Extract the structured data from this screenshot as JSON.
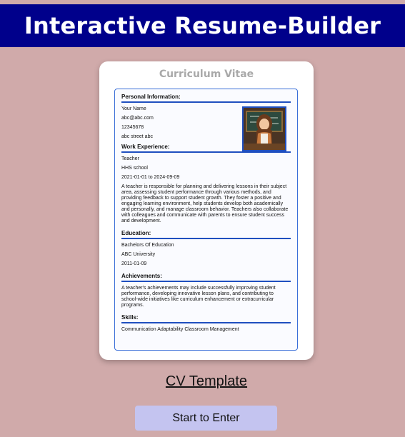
{
  "header": {
    "title": "Interactive Resume-Builder"
  },
  "card": {
    "title": "Curriculum Vitae",
    "personal": {
      "heading": "Personal Information:",
      "name": "Your Name",
      "email": "abc@abc.com",
      "phone": "12345678",
      "address": "abc street abc"
    },
    "work": {
      "heading": "Work Experience:",
      "role": "Teacher",
      "company": "HHS school",
      "dates": "2021-01-01 to 2024-09-09",
      "description": "A teacher is responsible for planning and delivering lessons in their subject area, assessing student performance through various methods, and providing feedback to support student growth. They foster a positive and engaging learning environment, help students develop both academically and personally, and manage classroom behavior. Teachers also collaborate with colleagues and communicate with parents to ensure student success and development."
    },
    "education": {
      "heading": "Education:",
      "degree": "Bachelors Of Education",
      "school": "ABC University",
      "date": "2011-01-09"
    },
    "achievements": {
      "heading": "Achievements:",
      "text": "A teacher's achievements may include successfully improving student performance, developing innovative lesson plans, and contributing to school-wide initiatives like curriculum enhancement or extracurricular programs."
    },
    "skills": {
      "heading": "Skills:",
      "text": "Communication Adaptability Classroom Management"
    }
  },
  "link": {
    "label": "CV Template"
  },
  "button": {
    "label": "Start to Enter"
  }
}
